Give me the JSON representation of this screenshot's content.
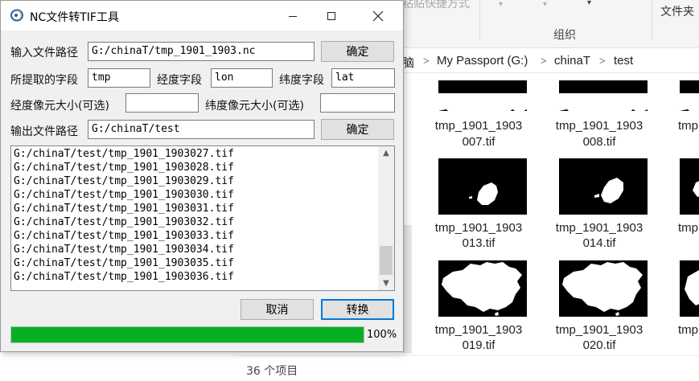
{
  "explorer": {
    "ribbon_fragment": "粘贴快捷方式",
    "ribbon_group": "组织",
    "ribbon_folder": "文件夹",
    "address": {
      "this_pc": "脑",
      "drive": "My Passport (G:)",
      "folder1": "chinaT",
      "folder2": "test",
      "separator": ">"
    },
    "files": [
      {
        "name_line1": "tmp_1901_1903",
        "name_line2": "007.tif"
      },
      {
        "name_line1": "tmp_1901_1903",
        "name_line2": "008.tif"
      },
      {
        "name_line1": "tmp",
        "name_line2": ""
      },
      {
        "name_line1": "tmp_1901_1903",
        "name_line2": "013.tif"
      },
      {
        "name_line1": "tmp_1901_1903",
        "name_line2": "014.tif"
      },
      {
        "name_line1": "tmp",
        "name_line2": ""
      },
      {
        "name_line1": "tmp_1901_1903",
        "name_line2": "019.tif"
      },
      {
        "name_line1": "tmp_1901_1903",
        "name_line2": "020.tif"
      },
      {
        "name_line1": "tmp",
        "name_line2": ""
      }
    ],
    "status_text": "36 个项目"
  },
  "dialog": {
    "title": "NC文件转TIF工具",
    "input_path_label": "输入文件路径",
    "input_path_value": "G:/chinaT/tmp_1901_1903.nc",
    "confirm_label": "确定",
    "field_label": "所提取的字段",
    "field_value": "tmp",
    "lon_label": "经度字段",
    "lon_value": "lon",
    "lat_label": "纬度字段",
    "lat_value": "lat",
    "lon_pixel_label": "经度像元大小(可选)",
    "lon_pixel_value": "",
    "lat_pixel_label": "纬度像元大小(可选)",
    "lat_pixel_value": "",
    "output_path_label": "输出文件路径",
    "output_path_value": "G:/chinaT/test",
    "log_lines": [
      "G:/chinaT/test/tmp_1901_1903027.tif",
      "G:/chinaT/test/tmp_1901_1903028.tif",
      "G:/chinaT/test/tmp_1901_1903029.tif",
      "G:/chinaT/test/tmp_1901_1903030.tif",
      "G:/chinaT/test/tmp_1901_1903031.tif",
      "G:/chinaT/test/tmp_1901_1903032.tif",
      "G:/chinaT/test/tmp_1901_1903033.tif",
      "G:/chinaT/test/tmp_1901_1903034.tif",
      "G:/chinaT/test/tmp_1901_1903035.tif",
      "G:/chinaT/test/tmp_1901_1903036.tif"
    ],
    "cancel_label": "取消",
    "convert_label": "转换",
    "progress_percent": 100,
    "progress_text": "100%",
    "progress_color": "#06b025"
  }
}
